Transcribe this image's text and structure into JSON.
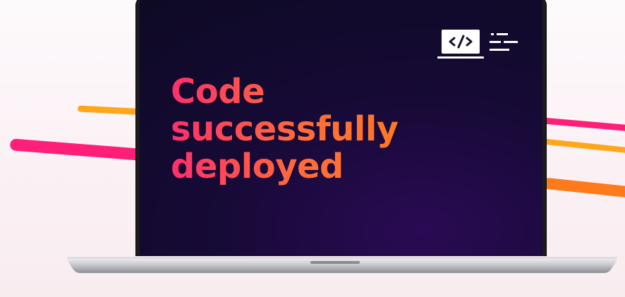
{
  "screen": {
    "headline_lines": [
      "Code",
      "successfully",
      "deployed"
    ]
  },
  "icons": {
    "screen_icon": "code-window-icon"
  },
  "colors": {
    "background": "#fbf1f5",
    "display_dark": "#0d0a22",
    "display_purple": "#2a0a54",
    "headline_pink": "#ff2f6d",
    "headline_orange": "#ff7a25",
    "streak_pink": "#ff1f78",
    "streak_orange": "#ff7a1a",
    "streak_amber": "#ffa61a"
  }
}
